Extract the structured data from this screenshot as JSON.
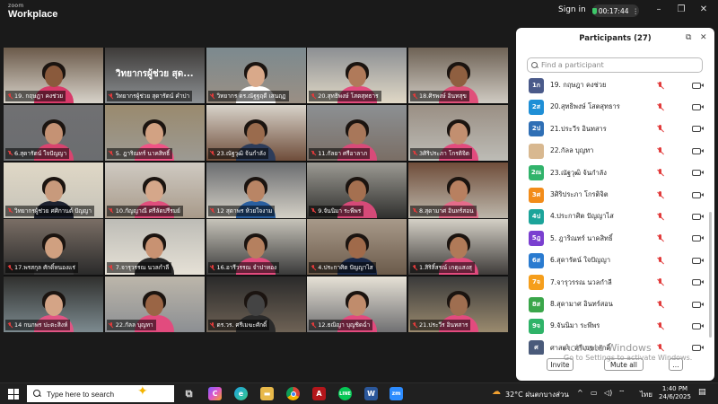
{
  "app": {
    "brand_small": "zoom",
    "brand_big": "Workplace"
  },
  "titlebar": {
    "signin": "Sign in",
    "timer": "00:17:44"
  },
  "grid": {
    "tiles": [
      {
        "name": "19. กฤษฎา คงช่วย",
        "caption": ""
      },
      {
        "name": "วิทยากรผู้ช่วย สุดารัตน์ คำปา",
        "caption": "วิทยากรผู้ช่วย สุด..."
      },
      {
        "name": "วิทยากร ดร.ณัฐฐฤดี เสนฤฏ",
        "caption": ""
      },
      {
        "name": "20.สุทธิพงษ์ โสตสุทธาร",
        "caption": ""
      },
      {
        "name": "18.ศิรพงษ์ อินทสุข",
        "caption": ""
      },
      {
        "name": "6.สุดารัตน์ ใจปัญญา",
        "caption": ""
      },
      {
        "name": "5. ฎาริณทร์ นาคสิทธิ์",
        "caption": ""
      },
      {
        "name": "23.ณัฐวุฒิ จ้นกำลัง",
        "caption": ""
      },
      {
        "name": "11.กัลยา ศรีอาลาภ",
        "caption": ""
      },
      {
        "name": "3ศิริประภา โกรติจิต",
        "caption": ""
      },
      {
        "name": "วิทยากรผู้ช่วย ศศิกานต์ ปัญญา",
        "caption": ""
      },
      {
        "name": "10.กัญญาณี ศรีลัดปรีรมย์",
        "caption": ""
      },
      {
        "name": "12 สุดาพร ห้วยใจงาม",
        "caption": ""
      },
      {
        "name": "9.จันนิมา ระพีพร",
        "caption": ""
      },
      {
        "name": "8.สุดามาศ อินทร์สอน",
        "caption": ""
      },
      {
        "name": "17.พรสกุล ศักดิ์หนองแร่",
        "caption": ""
      },
      {
        "name": "7.จารุวรรณ นวลกำลี",
        "caption": ""
      },
      {
        "name": "16.อารีวรรณ จำปาทอง",
        "caption": ""
      },
      {
        "name": "4.ประกาศิต ปัญญาไส",
        "caption": ""
      },
      {
        "name": "1.สิริสิ์สรณ์ เกตุแสงสุ",
        "caption": ""
      },
      {
        "name": "14 กนกพร ปะตะสิงห์",
        "caption": ""
      },
      {
        "name": "22.กัลล บุญทา",
        "caption": ""
      },
      {
        "name": "ดร.วร. ศรีเมฆะศักดิ์",
        "caption": ""
      },
      {
        "name": "12.ธณิญา บุญชิดฉ่ำ",
        "caption": ""
      },
      {
        "name": "21.ประวีร อินทสาร",
        "caption": ""
      }
    ]
  },
  "panel": {
    "title": "Participants (27)",
    "search_placeholder": "Find a participant",
    "participants": [
      {
        "initial": "1ก",
        "name": "19. กฤษฎา คงช่วย",
        "color": "#4a5a8a"
      },
      {
        "initial": "2ส",
        "name": "20.สุทธิพงษ์ โสตสุทธาร",
        "color": "#1f8fd6"
      },
      {
        "initial": "2ป",
        "name": "21.ประวีร อินทสาร",
        "color": "#2f6fb5"
      },
      {
        "initial": "",
        "name": "22.กัลล บุญทา",
        "color": "#d8b890"
      },
      {
        "initial": "2ณ",
        "name": "23.ณัฐวุฒิ จ้นกำลัง",
        "color": "#31b36b"
      },
      {
        "initial": "3ศ",
        "name": "3ศิริประภา โกรติจิต",
        "color": "#f28c1a"
      },
      {
        "initial": "4ป",
        "name": "4.ประกาศิต ปัญญาไส",
        "color": "#1ca49a"
      },
      {
        "initial": "5ฎ",
        "name": "5. ฎาริณทร์ นาคสิทธิ์",
        "color": "#7a3fd0"
      },
      {
        "initial": "6ส",
        "name": "6.สุดารัตน์ ใจปัญญา",
        "color": "#2a7bd0"
      },
      {
        "initial": "7จ",
        "name": "7.จารุวรรณ นวลกำลี",
        "color": "#f59e1c"
      },
      {
        "initial": "8ส",
        "name": "8.สุดามาศ อินทร์สอน",
        "color": "#3aa64a"
      },
      {
        "initial": "9จ",
        "name": "9.จันนิมา ระพีพร",
        "color": "#2fb368"
      },
      {
        "initial": "ศ",
        "name": "ศาสตร. ศรีเมฆะศักดิ์",
        "color": "#4a5a7a"
      }
    ],
    "invite_label": "Invite",
    "muteall_label": "Mute all",
    "more_label": "..."
  },
  "watermark": {
    "line1": "Activate Windows",
    "line2": "Go to Settings to activate Windows."
  },
  "taskbar": {
    "search_text": "Type here to search",
    "weather": "32°C ฝนตกบางส่วน",
    "lang": "ไทย",
    "time": "1:40 PM",
    "date": "24/6/2025"
  }
}
